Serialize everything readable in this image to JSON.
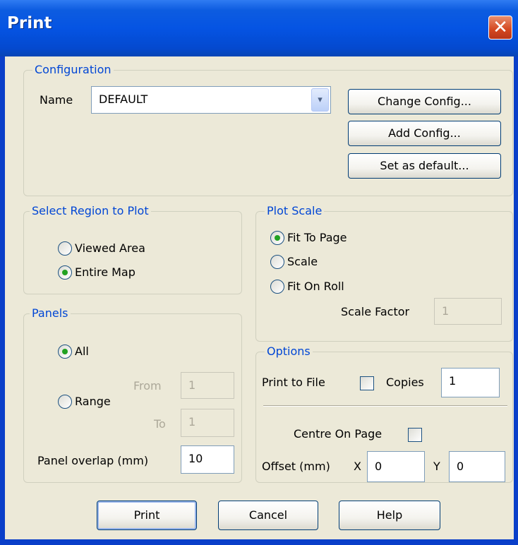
{
  "window": {
    "title": "Print",
    "close_icon": "✕"
  },
  "configuration": {
    "legend": "Configuration",
    "name_label": "Name",
    "name_value": "DEFAULT",
    "dropdown_icon": "▾",
    "change_config": "Change Config...",
    "add_config": "Add Config...",
    "set_default": "Set as default..."
  },
  "region": {
    "legend": "Select Region to Plot",
    "viewed_area": "Viewed Area",
    "entire_map": "Entire Map",
    "selected": "Entire Map"
  },
  "plot_scale": {
    "legend": "Plot Scale",
    "fit_to_page": "Fit To Page",
    "scale": "Scale",
    "fit_on_roll": "Fit On Roll",
    "selected": "Fit To Page",
    "scale_factor_label": "Scale Factor",
    "scale_factor_value": "1"
  },
  "panels": {
    "legend": "Panels",
    "all": "All",
    "range": "Range",
    "selected": "All",
    "from_label": "From",
    "from_value": "1",
    "to_label": "To",
    "to_value": "1",
    "overlap_label": "Panel overlap (mm)",
    "overlap_value": "10"
  },
  "options": {
    "legend": "Options",
    "print_to_file_label": "Print to File",
    "print_to_file_checked": false,
    "copies_label": "Copies",
    "copies_value": "1",
    "centre_label": "Centre On Page",
    "centre_checked": false,
    "offset_label": "Offset (mm)",
    "x_label": "X",
    "x_value": "0",
    "y_label": "Y",
    "y_value": "0"
  },
  "buttons": {
    "print": "Print",
    "cancel": "Cancel",
    "help": "Help"
  },
  "colors": {
    "title_bar": "#0554e3",
    "dialog_bg": "#ece9d8",
    "group_label": "#0046d5",
    "radio_dot": "#21a121",
    "close_button": "#d4471f"
  }
}
